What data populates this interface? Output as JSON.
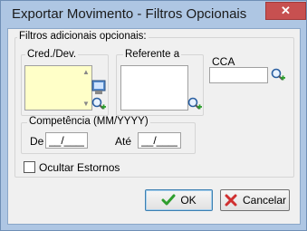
{
  "window": {
    "title": "Exportar Movimento - Filtros Opcionais",
    "close_glyph": "✕"
  },
  "filters": {
    "group_label": "Filtros adicionais opcionais:",
    "cred_dev": {
      "label": "Cred./Dev.",
      "highlight_color": "#ffffc8"
    },
    "referente": {
      "label": "Referente a"
    },
    "cca": {
      "label": "CCA",
      "value": ""
    }
  },
  "competencia": {
    "label": "Competência (MM/YYYY)",
    "de_label": "De",
    "de_value": "__/____",
    "ate_label": "Até",
    "ate_value": "__/____"
  },
  "ocultar_estornos": {
    "label": "Ocultar Estornos",
    "checked": false
  },
  "buttons": {
    "ok": {
      "label": "OK",
      "icon": "checkmark-icon",
      "icon_color": "#2e9e2e"
    },
    "cancel": {
      "label": "Cancelar",
      "icon": "cross-icon",
      "icon_color": "#d03030"
    }
  }
}
